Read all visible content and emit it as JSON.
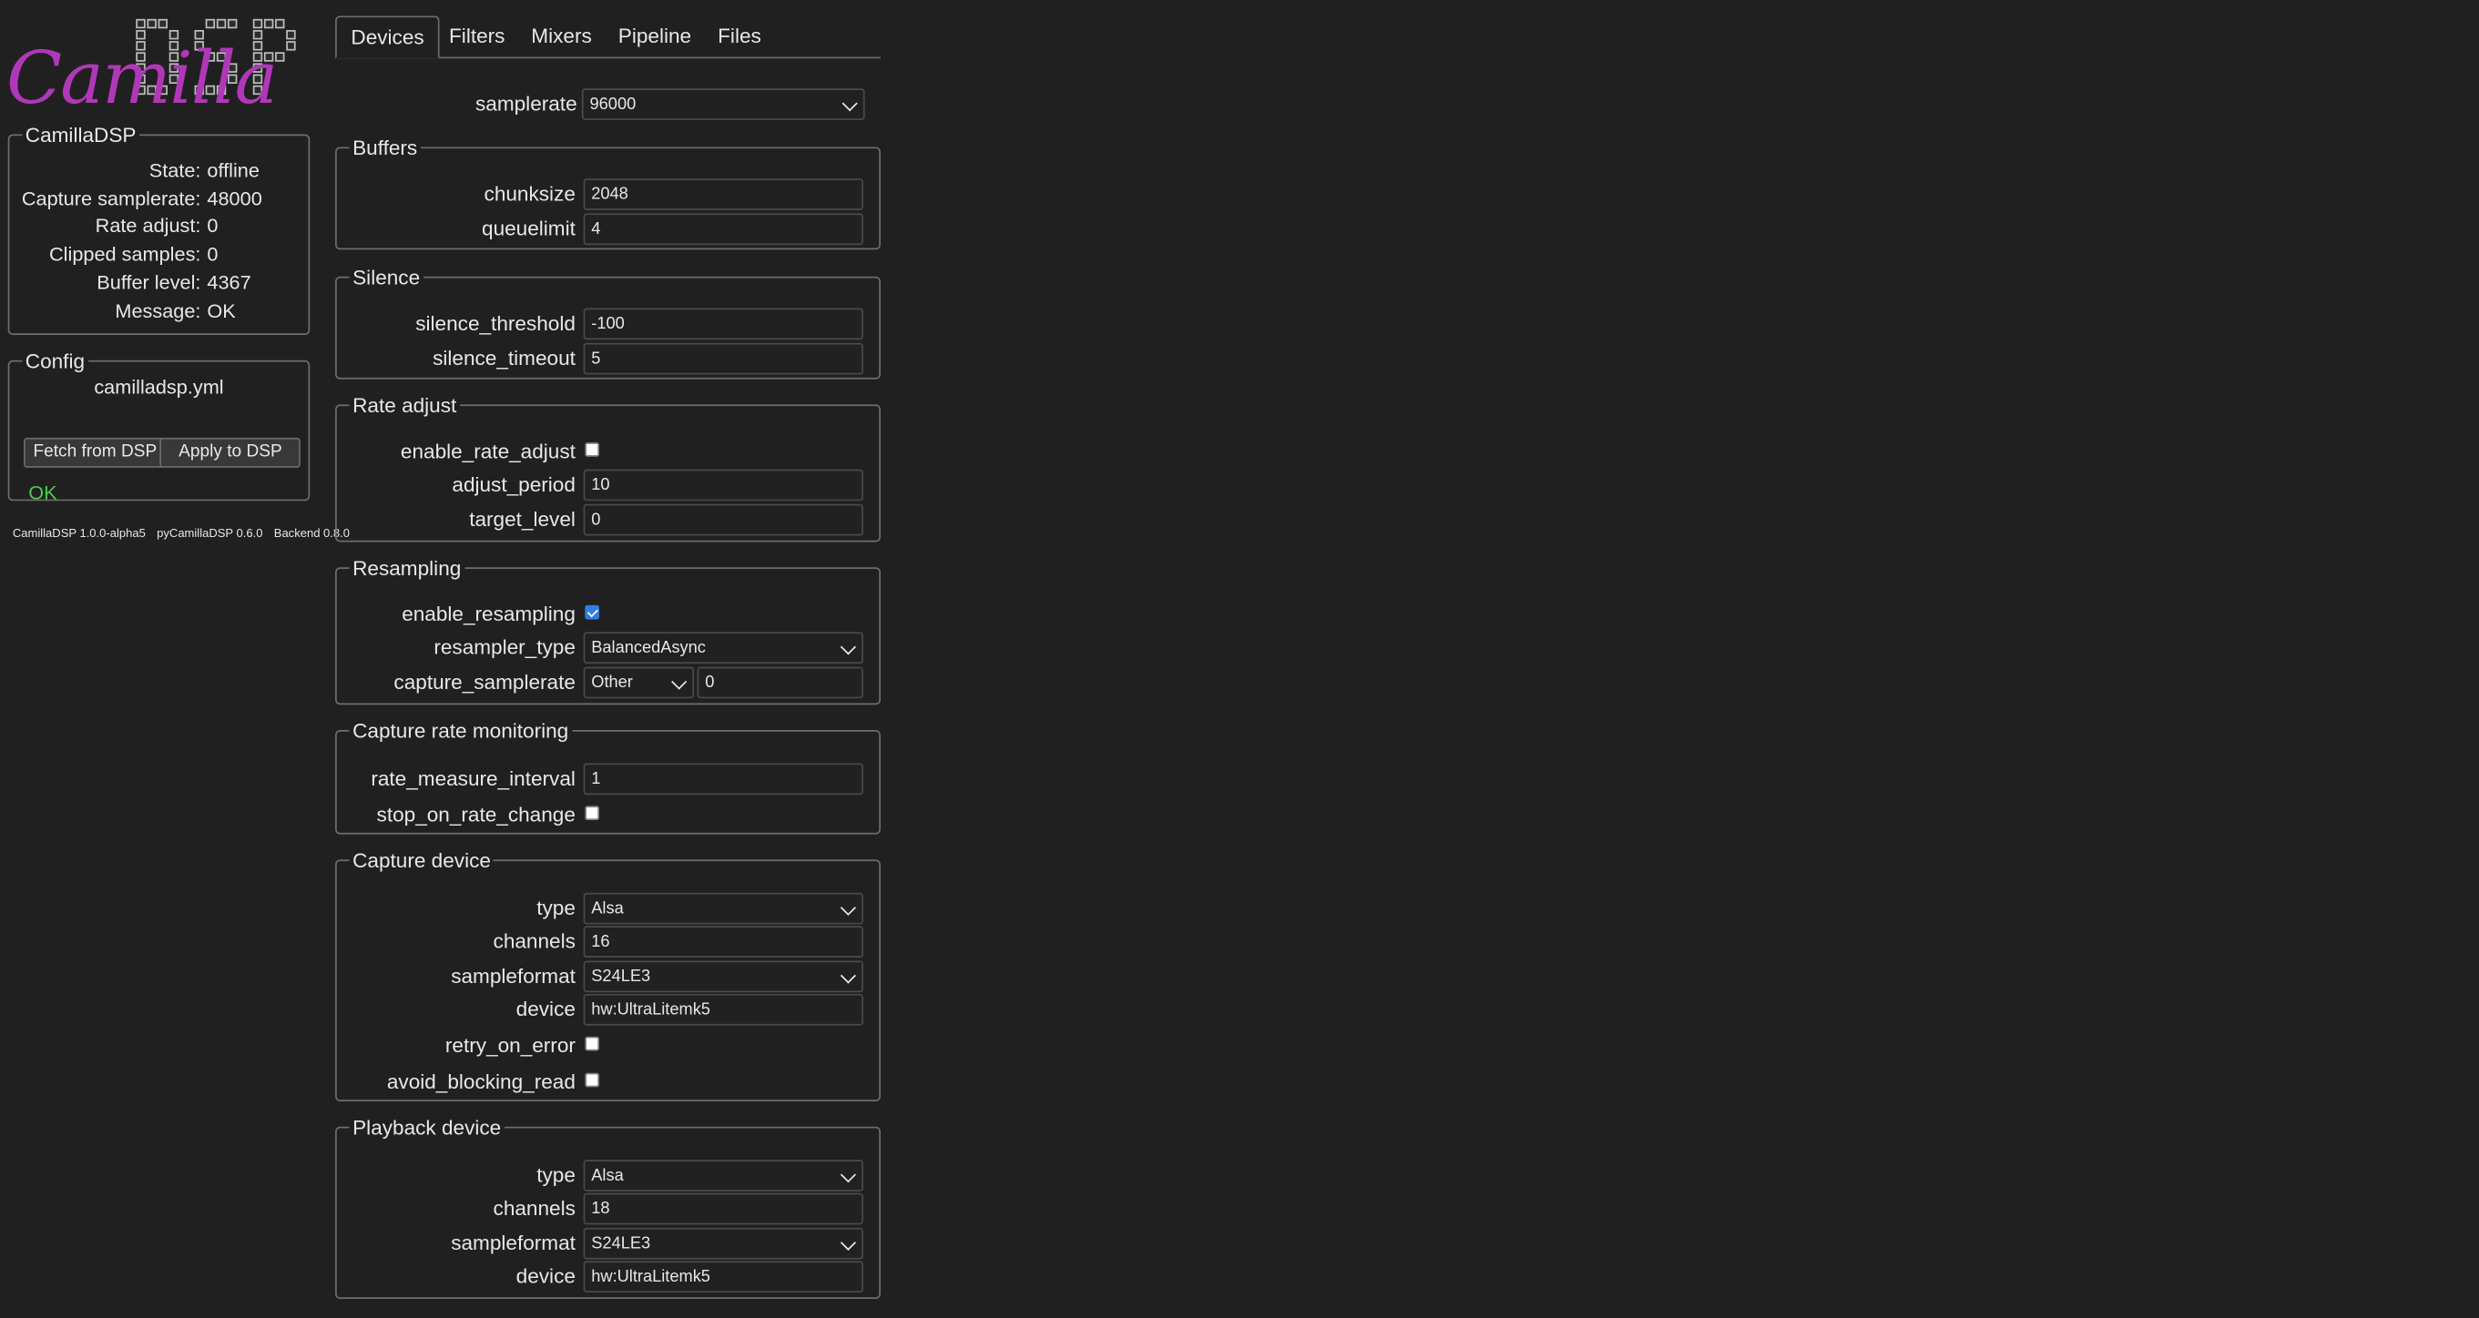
{
  "logo": {
    "script_text": "Camilla",
    "block_text": "DSP"
  },
  "status": {
    "legend": "CamillaDSP",
    "rows": [
      {
        "key": "State:",
        "value": "offline"
      },
      {
        "key": "Capture samplerate:",
        "value": "48000"
      },
      {
        "key": "Rate adjust:",
        "value": "0"
      },
      {
        "key": "Clipped samples:",
        "value": "0"
      },
      {
        "key": "Buffer level:",
        "value": "4367"
      },
      {
        "key": "Message:",
        "value": "OK"
      }
    ]
  },
  "config": {
    "legend": "Config",
    "filename": "camilladsp.yml",
    "fetch_label": "Fetch from DSP",
    "apply_label": "Apply to DSP",
    "result": "OK",
    "result_color": "#4ccb4c"
  },
  "versions": {
    "camilladsp": "CamillaDSP 1.0.0-alpha5",
    "pycamilladsp": "pyCamillaDSP 0.6.0",
    "backend": "Backend 0.8.0"
  },
  "tabs": [
    "Devices",
    "Filters",
    "Mixers",
    "Pipeline",
    "Files"
  ],
  "active_tab": "Devices",
  "devices": {
    "samplerate": {
      "label": "samplerate",
      "value": "96000"
    },
    "buffers": {
      "legend": "Buffers",
      "chunksize": {
        "label": "chunksize",
        "value": "2048"
      },
      "queuelimit": {
        "label": "queuelimit",
        "value": "4"
      }
    },
    "silence": {
      "legend": "Silence",
      "silence_threshold": {
        "label": "silence_threshold",
        "value": "-100"
      },
      "silence_timeout": {
        "label": "silence_timeout",
        "value": "5"
      }
    },
    "rate_adjust": {
      "legend": "Rate adjust",
      "enable_rate_adjust": {
        "label": "enable_rate_adjust",
        "checked": false
      },
      "adjust_period": {
        "label": "adjust_period",
        "value": "10"
      },
      "target_level": {
        "label": "target_level",
        "value": "0"
      }
    },
    "resampling": {
      "legend": "Resampling",
      "enable_resampling": {
        "label": "enable_resampling",
        "checked": true
      },
      "resampler_type": {
        "label": "resampler_type",
        "value": "BalancedAsync"
      },
      "capture_samplerate": {
        "label": "capture_samplerate",
        "select_value": "Other",
        "input_value": "0"
      }
    },
    "capture_rate_monitoring": {
      "legend": "Capture rate monitoring",
      "rate_measure_interval": {
        "label": "rate_measure_interval",
        "value": "1"
      },
      "stop_on_rate_change": {
        "label": "stop_on_rate_change",
        "checked": false
      }
    },
    "capture": {
      "legend": "Capture device",
      "type": {
        "label": "type",
        "value": "Alsa"
      },
      "channels": {
        "label": "channels",
        "value": "16"
      },
      "sampleformat": {
        "label": "sampleformat",
        "value": "S24LE3"
      },
      "device": {
        "label": "device",
        "value": "hw:UltraLitemk5"
      },
      "retry_on_error": {
        "label": "retry_on_error",
        "checked": false
      },
      "avoid_blocking_read": {
        "label": "avoid_blocking_read",
        "checked": false
      }
    },
    "playback": {
      "legend": "Playback device",
      "type": {
        "label": "type",
        "value": "Alsa"
      },
      "channels": {
        "label": "channels",
        "value": "18"
      },
      "sampleformat": {
        "label": "sampleformat",
        "value": "S24LE3"
      },
      "device": {
        "label": "device",
        "value": "hw:UltraLitemk5"
      }
    }
  }
}
